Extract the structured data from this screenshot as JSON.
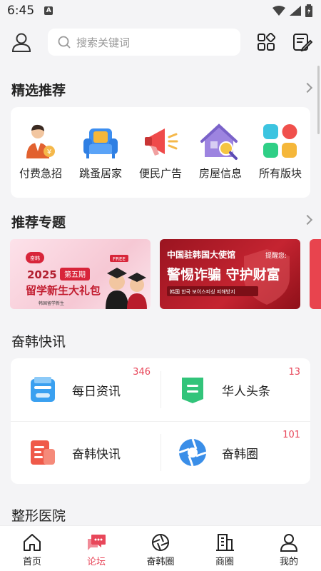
{
  "status": {
    "time": "6:45",
    "a_label": "A"
  },
  "search": {
    "placeholder": "搜索关键词"
  },
  "featured": {
    "title": "精选推荐",
    "items": [
      {
        "label": "付费急招",
        "icon": "recruiter-icon"
      },
      {
        "label": "跳蚤居家",
        "icon": "sofa-icon"
      },
      {
        "label": "便民广告",
        "icon": "megaphone-icon"
      },
      {
        "label": "房屋信息",
        "icon": "house-search-icon"
      },
      {
        "label": "所有版块",
        "icon": "grid-blocks-icon"
      }
    ]
  },
  "topics": {
    "title": "推荐专题",
    "banners": [
      {
        "year": "2025",
        "period": "第五期",
        "free": "FREE",
        "headline": "留学新生大礼包",
        "sub": "韩国留学新生",
        "brand": "奋韩"
      },
      {
        "line1": "中国驻韩国大使馆",
        "tag": "提醒您:",
        "headline": "警惕诈骗 守护财富",
        "footer": "韩国 한국 보이스피싱 피해방지"
      }
    ]
  },
  "news": {
    "title": "奋韩快讯",
    "items": [
      {
        "label": "每日资讯",
        "count": "346",
        "icon": "daily-news-icon"
      },
      {
        "label": "华人头条",
        "count": "13",
        "icon": "headline-icon"
      },
      {
        "label": "奋韩快讯",
        "count": "",
        "icon": "flash-news-icon"
      },
      {
        "label": "奋韩圈",
        "count": "101",
        "icon": "circle-icon"
      }
    ]
  },
  "next_section": {
    "title": "整形医院"
  },
  "tabbar": {
    "active": "论坛",
    "tabs": [
      {
        "label": "首页",
        "icon": "home-icon"
      },
      {
        "label": "论坛",
        "icon": "forum-icon"
      },
      {
        "label": "奋韩圈",
        "icon": "aperture-icon"
      },
      {
        "label": "商圈",
        "icon": "building-icon"
      },
      {
        "label": "我的",
        "icon": "profile-icon"
      }
    ]
  },
  "colors": {
    "accent": "#e8475a",
    "background": "#f4f4f6"
  }
}
